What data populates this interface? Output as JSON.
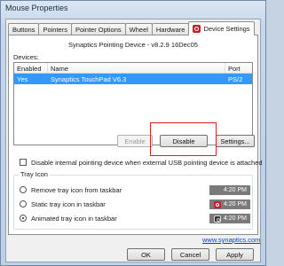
{
  "window": {
    "title": "Mouse Properties"
  },
  "tabs": [
    {
      "label": "Buttons"
    },
    {
      "label": "Pointers"
    },
    {
      "label": "Pointer Options"
    },
    {
      "label": "Wheel"
    },
    {
      "label": "Hardware"
    },
    {
      "label": "Device Settings",
      "active": true
    }
  ],
  "panel": {
    "version_text": "Synaptics Pointing Device - v8.2.9 16Dec05",
    "devices_label": "Devices:",
    "columns": [
      "Enabled",
      "Name",
      "Port"
    ],
    "rows": [
      {
        "enabled": "Yes",
        "name": "Synaptics TouchPad V6.3",
        "port": "PS/2",
        "selected": true
      }
    ],
    "buttons": {
      "enable": "Enable",
      "disable": "Disable",
      "settings": "Settings..."
    },
    "checkbox_label": "Disable internal pointing device when external USB pointing device is attached",
    "tray": {
      "group_title": "Tray Icon",
      "options": [
        {
          "label": "Remove tray icon from taskbar",
          "time": "4:20 PM",
          "icon": "none",
          "checked": false
        },
        {
          "label": "Static tray icon in taskbar",
          "time": "4:20 PM",
          "icon": "synaptics-icon",
          "checked": false
        },
        {
          "label": "Animated tray icon in taskbar",
          "time": "4:20 PM",
          "icon": "animated-touchpad-icon",
          "checked": true
        }
      ]
    },
    "link": "www.synaptics.com"
  },
  "footer": {
    "ok": "OK",
    "cancel": "Cancel",
    "apply": "Apply"
  },
  "colors": {
    "selection": "#3399ff",
    "highlight": "#e02020",
    "brand": "#c4202b",
    "link": "#0046c5"
  }
}
